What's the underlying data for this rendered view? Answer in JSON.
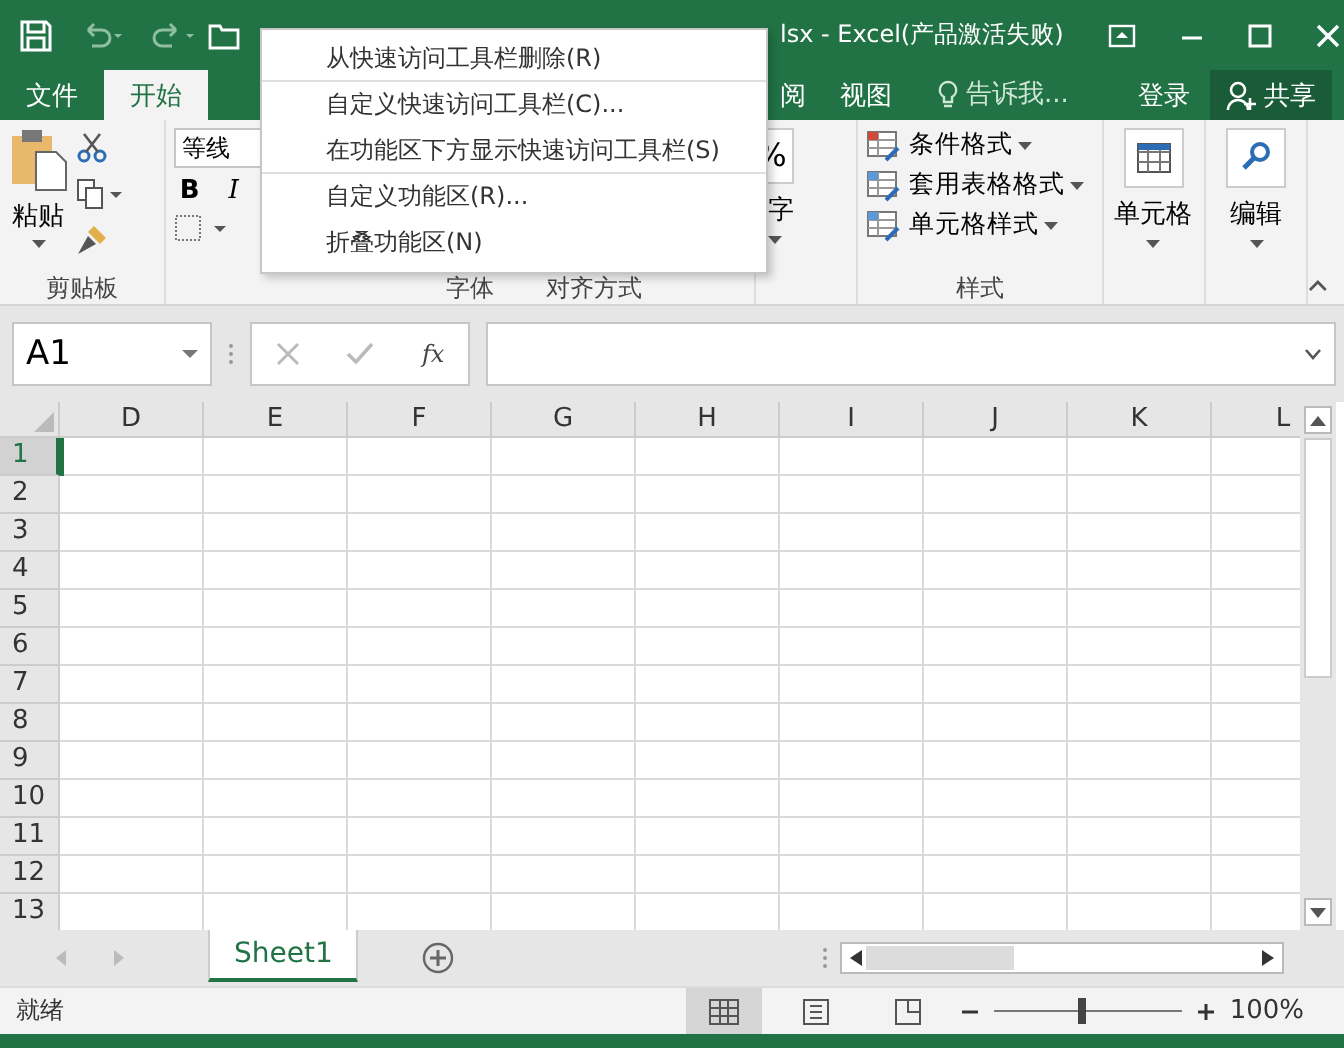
{
  "title_bar": {
    "title": "lsx - Excel(产品激活失败)"
  },
  "ribbon_tabs": [
    {
      "label": "文件",
      "selected": false
    },
    {
      "label": "开始",
      "selected": true
    },
    {
      "label": "阅",
      "selected": false
    },
    {
      "label": "视图",
      "selected": false
    }
  ],
  "tell_me": {
    "placeholder": "告诉我..."
  },
  "sign_in": "登录",
  "share": "共享",
  "ribbon": {
    "paste": "粘贴",
    "clipboard_label": "剪贴板",
    "font_name": "等线",
    "bold": "B",
    "italic": "I",
    "font_label": "字体",
    "alignment_label": "对齐方式",
    "percent": "%",
    "number_label": "字",
    "styles": [
      "条件格式",
      "套用表格格式",
      "单元格样式"
    ],
    "styles_label": "样式",
    "cells": "单元格",
    "editing": "编辑"
  },
  "context_menu": [
    {
      "label": "从快速访问工具栏删除(R)",
      "divider_after": true
    },
    {
      "label": "自定义快速访问工具栏(C)...",
      "divider_after": false
    },
    {
      "label": "在功能区下方显示快速访问工具栏(S)",
      "divider_after": true
    },
    {
      "label": "自定义功能区(R)...",
      "divider_after": false
    },
    {
      "label": "折叠功能区(N)",
      "divider_after": false
    }
  ],
  "name_box": {
    "value": "A1"
  },
  "fx": "fx",
  "columns": [
    "D",
    "E",
    "F",
    "G",
    "H",
    "I",
    "J",
    "K",
    "L"
  ],
  "rows": [
    {
      "label": "1",
      "selected": true
    },
    {
      "label": "2",
      "selected": false
    },
    {
      "label": "3",
      "selected": false
    },
    {
      "label": "4",
      "selected": false
    },
    {
      "label": "5",
      "selected": false
    },
    {
      "label": "6",
      "selected": false
    },
    {
      "label": "7",
      "selected": false
    },
    {
      "label": "8",
      "selected": false
    },
    {
      "label": "9",
      "selected": false
    },
    {
      "label": "10",
      "selected": false
    },
    {
      "label": "11",
      "selected": false
    },
    {
      "label": "12",
      "selected": false
    },
    {
      "label": "13",
      "selected": false
    }
  ],
  "sheet_tabs": [
    {
      "label": "Sheet1",
      "selected": true
    }
  ],
  "status_bar": {
    "status": "就绪",
    "views": [
      {
        "selected": true
      },
      {
        "selected": false
      },
      {
        "selected": false
      }
    ],
    "zoom": {
      "level": 0.47
    },
    "zoom_reading": "100%"
  }
}
